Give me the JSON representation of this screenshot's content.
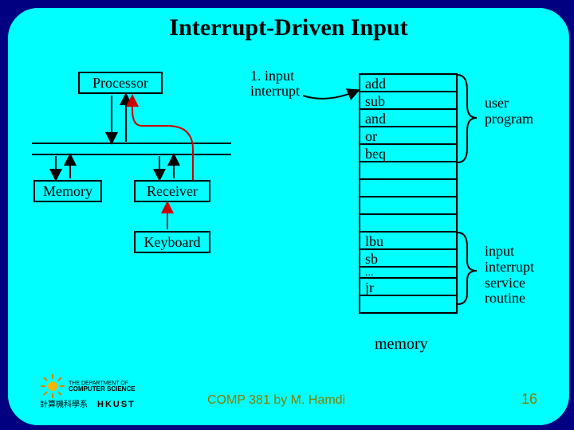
{
  "title": "Interrupt-Driven Input",
  "boxes": {
    "processor": "Processor",
    "memory": "Memory",
    "receiver": "Receiver",
    "keyboard": "Keyboard"
  },
  "labels": {
    "input_interrupt": "1. input\ninterrupt",
    "user_program": "user\nprogram",
    "isr": "input\ninterrupt\nservice\nroutine",
    "memory_caption": "memory"
  },
  "memory_rows": {
    "user": [
      "add",
      "sub",
      "and",
      "or",
      "beq"
    ],
    "isr": [
      "lbu",
      "sb",
      "...",
      "jr"
    ]
  },
  "footer": {
    "course": "COMP 381 by M. Hamdi",
    "page": "16",
    "dept_line1": "THE DEPARTMENT OF",
    "dept_line2": "COMPUTER SCIENCE",
    "univ_cn": "計算機科學系",
    "univ_en": "HKUST"
  },
  "colors": {
    "slide_bg": "#00ffff",
    "outer_bg": "#000080",
    "accent_olive": "#808000"
  }
}
